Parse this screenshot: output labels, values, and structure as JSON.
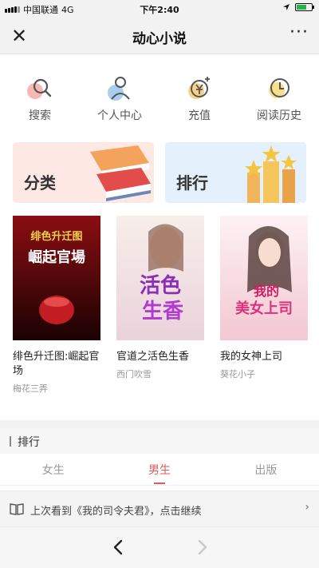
{
  "status": {
    "carrier": "中国联通",
    "network": "4G",
    "time": "下午2:40"
  },
  "nav": {
    "title": "动心小说",
    "close_icon": "close-icon",
    "more_icon": "more-dots-icon",
    "more_text": "···"
  },
  "quick_menu": [
    {
      "label": "搜索",
      "icon": "search-icon"
    },
    {
      "label": "个人中心",
      "icon": "user-icon"
    },
    {
      "label": "充值",
      "icon": "recharge-coin-icon"
    },
    {
      "label": "阅读历史",
      "icon": "clock-icon"
    }
  ],
  "cards": {
    "category": "分类",
    "ranking": "排行"
  },
  "books": [
    {
      "title": "绯色升迁图:崛起官场",
      "author": "梅花三弄",
      "cover_text": "绯色升迁图 崛起官場",
      "cover_colors": [
        "#8b0e12",
        "#1b0203"
      ]
    },
    {
      "title": "官道之活色生香",
      "author": "西门吹雪",
      "cover_text": "活色生香",
      "cover_colors": [
        "#f5e6e6",
        "#e8d0d8"
      ]
    },
    {
      "title": "我的女神上司",
      "author": "葵花小子",
      "cover_text": "我的美女上司",
      "cover_colors": [
        "#fbe9ee",
        "#f2c6cf"
      ]
    }
  ],
  "section": {
    "title": "排行"
  },
  "tabs": [
    {
      "label": "女生",
      "active": false
    },
    {
      "label": "男生",
      "active": true
    },
    {
      "label": "出版",
      "active": false
    }
  ],
  "continue_reading": {
    "text": "上次看到《我的司令夫君》，点击继续",
    "icon": "book-open-icon"
  },
  "colors": {
    "accent": "#e05a5a",
    "background": "#f2f2f2"
  }
}
